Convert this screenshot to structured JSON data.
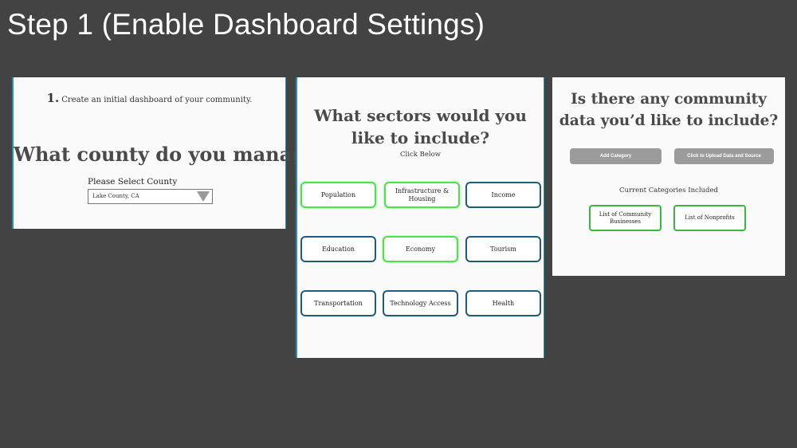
{
  "slide": {
    "title": "Step 1 (Enable Dashboard Settings)"
  },
  "panel1": {
    "step_number": "1.",
    "step_text": "Create an initial dashboard of your community.",
    "question": "What county do you manage?",
    "select_label": "Please Select County",
    "select_value": "Lake County, CA"
  },
  "panel2": {
    "question": "What sectors would you like to include?",
    "subtitle": "Click Below",
    "sectors": [
      {
        "label": "Population",
        "selected": true
      },
      {
        "label": "Infrastructure & Housing",
        "selected": true
      },
      {
        "label": "Income",
        "selected": false
      },
      {
        "label": "Education",
        "selected": false
      },
      {
        "label": "Economy",
        "selected": true
      },
      {
        "label": "Tourism",
        "selected": false
      },
      {
        "label": "Transportation",
        "selected": false
      },
      {
        "label": "Technology Access",
        "selected": false
      },
      {
        "label": "Health",
        "selected": false
      }
    ]
  },
  "panel3": {
    "question": "Is there any community data you’d like to include?",
    "add_category_label": "Add Category",
    "upload_label": "Click to Upload Data and Source",
    "current_label": "Current Categories Included",
    "categories": [
      "List of Community Businesses",
      "List of Nonprofits"
    ]
  },
  "colors": {
    "background": "#434343",
    "selected_border": "#4be24b",
    "unselected_border": "#1e5d7a",
    "category_border": "#3ab83a",
    "button_gray": "#9b9b9b"
  }
}
